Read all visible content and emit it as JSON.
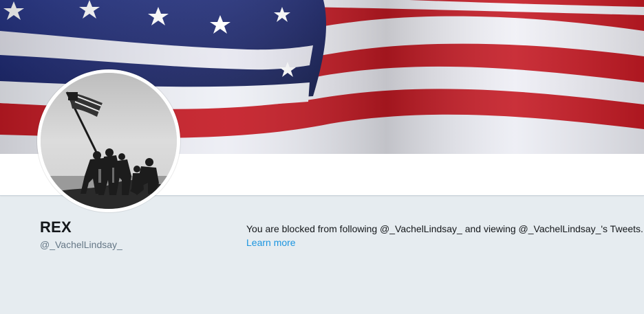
{
  "profile": {
    "name": "REX",
    "handle": "@_VachelLindsay_",
    "banner_icon": "us-flag-banner",
    "avatar_icon": "flag-raising-photo-avatar"
  },
  "blocked": {
    "message": "You are blocked from following @_VachelLindsay_ and viewing @_VachelLindsay_'s Tweets.",
    "learn_more": "Learn more"
  },
  "colors": {
    "page_background": "#e6ecf0",
    "link": "#1b95e0",
    "name_text": "#14171a",
    "handle_text": "#657786",
    "flag_red": "#c41a24",
    "flag_blue": "#1f2a6b",
    "flag_white": "#f3f3f8"
  }
}
